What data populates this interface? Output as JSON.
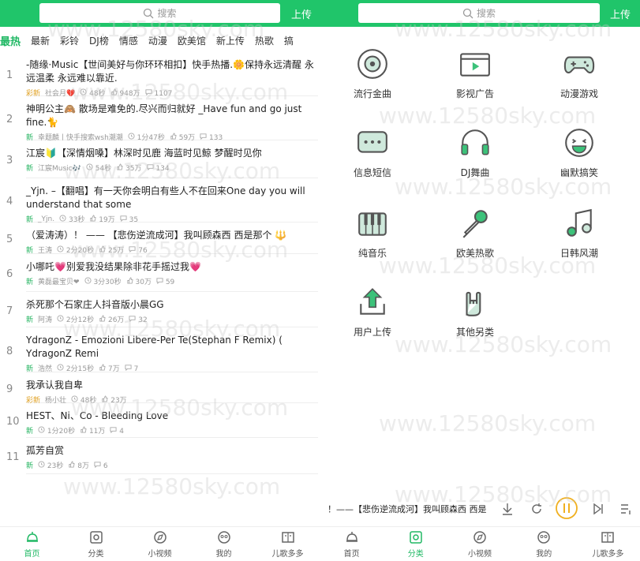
{
  "left": {
    "search_placeholder": "搜索",
    "upload_label": "上传",
    "tabs": [
      "最热",
      "最新",
      "彩铃",
      "DJ榜",
      "情感",
      "动漫",
      "欧美馆",
      "新上传",
      "热歌",
      "搞"
    ],
    "songs": [
      {
        "rank": "1",
        "title": "-随缘·Music【世间美好与你环环相扣】快手热播.🌼保持永远清醒 永远温柔 永远难以靠近.",
        "tag": "彩新",
        "tag_type": "hot",
        "user": "社会月💔",
        "duration": "48秒",
        "likes": "948万",
        "comments": "1107"
      },
      {
        "rank": "2",
        "title": "神明公主🙈 散场是难免的.尽兴而归就好 _Have fun and go just fine.🐈",
        "tag": "新",
        "tag_type": "new",
        "user": "幸题麟丨快手搜索wsh潮潮",
        "duration": "1分47秒",
        "likes": "59万",
        "comments": "133"
      },
      {
        "rank": "3",
        "title": "江宸🔰【深情烟嗓】林深时见鹿 海蓝时见鲸 梦醒时见你",
        "tag": "新",
        "tag_type": "new",
        "user": "江宸Music🎶",
        "duration": "54秒",
        "likes": "35万",
        "comments": "134"
      },
      {
        "rank": "4",
        "title": "_Yjn. –【翻唱】有一天你会明白有些人不在回来One day you will understand that some",
        "tag": "新",
        "tag_type": "new",
        "user": "_Yjn.",
        "duration": "33秒",
        "likes": "19万",
        "comments": "35"
      },
      {
        "rank": "5",
        "title": "（爱涛涛）！ —— 【悲伤逆流成河】我叫顾森西 西是那个 🔱",
        "tag": "新",
        "tag_type": "new",
        "user": "王涛",
        "duration": "2分20秒",
        "likes": "25万",
        "comments": "76"
      },
      {
        "rank": "6",
        "title": "小哪吒💗别爱我没结果除非花手摇过我💗",
        "tag": "新",
        "tag_type": "new",
        "user": "黄磊最宝贝❤",
        "duration": "3分30秒",
        "likes": "30万",
        "comments": "59"
      },
      {
        "rank": "7",
        "title": "杀死那个石家庄人抖音版小晨GG",
        "tag": "新",
        "tag_type": "new",
        "user": "阿涛",
        "duration": "2分12秒",
        "likes": "26万",
        "comments": "32"
      },
      {
        "rank": "8",
        "title": "YdragonZ - Emozioni Libere-Per Te(Stephan F Remix) ( YdragonZ Remi",
        "tag": "新",
        "tag_type": "new",
        "user": "浩然",
        "duration": "2分15秒",
        "likes": "7万",
        "comments": "7"
      },
      {
        "rank": "9",
        "title": "我承认我自卑",
        "tag": "彩新",
        "tag_type": "hot",
        "user": "杨小壮",
        "duration": "48秒",
        "likes": "23万",
        "comments": ""
      },
      {
        "rank": "10",
        "title": "HEST、Ni、Co - Bleeding Love",
        "tag": "新",
        "tag_type": "new",
        "user": "",
        "duration": "1分20秒",
        "likes": "11万",
        "comments": "4"
      },
      {
        "rank": "11",
        "title": "孤芳自赏",
        "tag": "新",
        "tag_type": "new",
        "user": "",
        "duration": "23秒",
        "likes": "8万",
        "comments": "6"
      }
    ],
    "nav": [
      "首页",
      "分类",
      "小视频",
      "我的",
      "儿歌多多"
    ]
  },
  "right": {
    "search_placeholder": "搜索",
    "upload_label": "上传",
    "categories": [
      {
        "label": "流行金曲",
        "icon": "disc-icon"
      },
      {
        "label": "影视广告",
        "icon": "film-icon"
      },
      {
        "label": "动漫游戏",
        "icon": "gamepad-icon"
      },
      {
        "label": "信息短信",
        "icon": "message-icon"
      },
      {
        "label": "DJ舞曲",
        "icon": "headphones-icon"
      },
      {
        "label": "幽默搞笑",
        "icon": "laugh-icon"
      },
      {
        "label": "纯音乐",
        "icon": "piano-icon"
      },
      {
        "label": "欧美热歌",
        "icon": "microphone-icon"
      },
      {
        "label": "日韩风潮",
        "icon": "music-note-icon"
      },
      {
        "label": "用户上传",
        "icon": "upload-icon"
      },
      {
        "label": "其他另类",
        "icon": "rock-hand-icon"
      }
    ],
    "now_playing": "！——【悲伤逆流成河】我叫顾森西 西是",
    "nav": [
      "首页",
      "分类",
      "小视频",
      "我的",
      "儿歌多多"
    ]
  },
  "watermark": "www.12580sky.com",
  "colors": {
    "accent": "#20c56a"
  }
}
